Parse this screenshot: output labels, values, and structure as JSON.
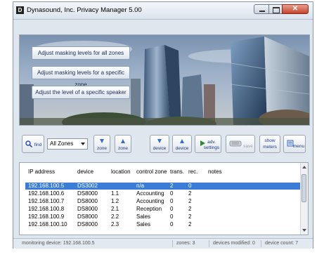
{
  "window": {
    "title": "Dynasound, Inc.  Privacy Manager 5.00",
    "app_icon": "D"
  },
  "banner": {
    "buttons": [
      "Adjust masking levels for all zones",
      "Adjust masking levels for a specific zone",
      "Adjust the level of a specific speaker"
    ]
  },
  "toolbar": {
    "find": "find",
    "zone_select": "All Zones",
    "zone_down": "zone",
    "zone_up": "zone",
    "device_down": "device",
    "device_up": "device",
    "adv_settings_1": "adv.",
    "adv_settings_2": "settings",
    "save": "save",
    "show_meters_1": "show",
    "show_meters_2": "meters",
    "menu": "menu"
  },
  "table": {
    "columns": [
      "IP address",
      "device",
      "location",
      "control zone",
      "trans.",
      "rec.",
      "notes"
    ],
    "rows": [
      [
        "192.168.100.5",
        "DS3002",
        "",
        "n/a",
        "2",
        "0",
        ""
      ],
      [
        "192.168.100.6",
        "DS8000",
        "1.1",
        "Accounting",
        "0",
        "2",
        ""
      ],
      [
        "192.168.100.7",
        "DS8000",
        "1.2",
        "Accounting",
        "0",
        "2",
        ""
      ],
      [
        "192.168.100.8",
        "DS8000",
        "2.1",
        "Reception",
        "0",
        "2",
        ""
      ],
      [
        "192.168.100.9",
        "DS8000",
        "2.2",
        "Sales",
        "0",
        "2",
        ""
      ],
      [
        "192.168.100.10",
        "DS8000",
        "2.3",
        "Sales",
        "0",
        "2",
        ""
      ]
    ]
  },
  "status": {
    "monitoring": "monitoring device: 192.168.100.5",
    "zones": "zones: 3",
    "modified": "devices modified: 0",
    "count": "device count: 7"
  },
  "colors": {
    "selection": "#3b7dd6",
    "button_text": "#1a2c52",
    "close_button": "#c4432c"
  }
}
